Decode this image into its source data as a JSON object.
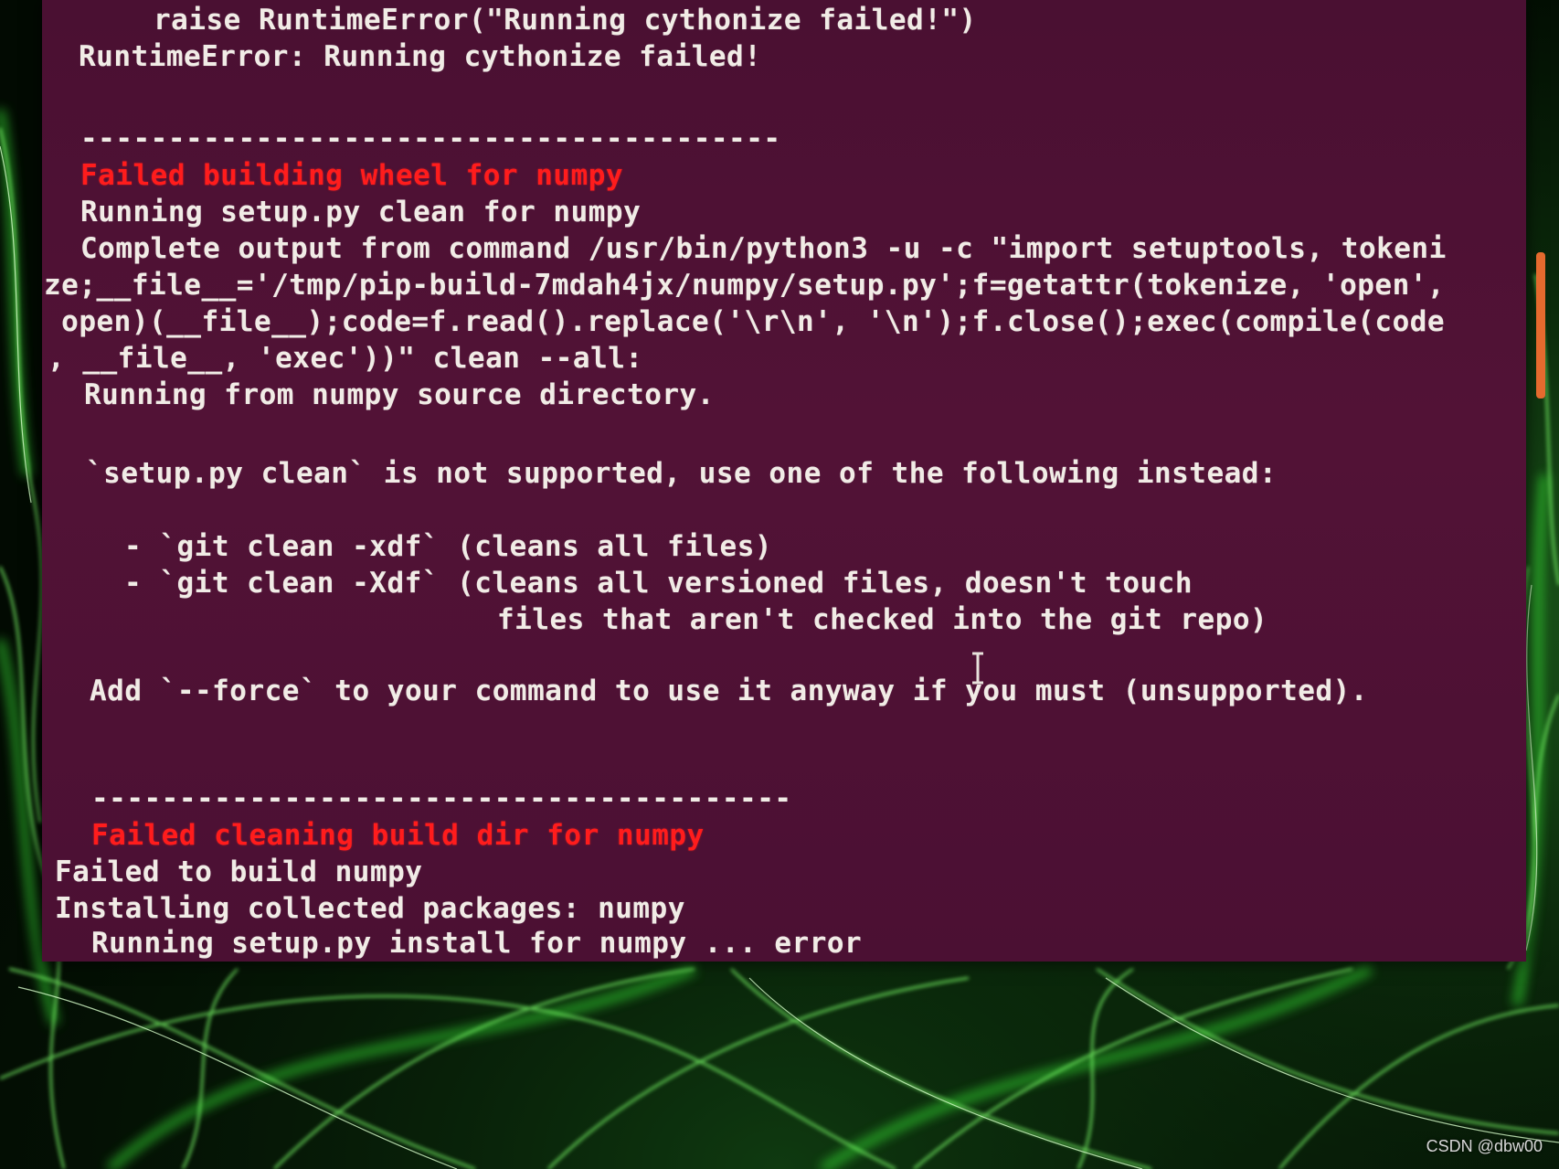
{
  "terminal": {
    "lines": [
      {
        "text": "raise RuntimeError(\"Running cythonize failed!\")",
        "color": "#f1ece6"
      },
      {
        "text": "RuntimeError: Running cythonize failed!",
        "color": "#f1ece6"
      },
      {
        "text": "----------------------------------------",
        "color": "#f1ece6"
      },
      {
        "text": "Failed building wheel for numpy",
        "color": "#ff1c1c"
      },
      {
        "text": "Running setup.py clean for numpy",
        "color": "#f1ece6"
      },
      {
        "text": "Complete output from command /usr/bin/python3 -u -c \"import setuptools, tokeni",
        "color": "#f1ece6"
      },
      {
        "text": "ze;__file__='/tmp/pip-build-7mdah4jx/numpy/setup.py';f=getattr(tokenize, 'open',",
        "color": "#f1ece6"
      },
      {
        "text": " open)(__file__);code=f.read().replace('\\r\\n', '\\n');f.close();exec(compile(code",
        "color": "#f1ece6"
      },
      {
        "text": ", __file__, 'exec'))\" clean --all:",
        "color": "#f1ece6"
      },
      {
        "text": "Running from numpy source directory.",
        "color": "#f1ece6"
      },
      {
        "text": "`setup.py clean` is not supported, use one of the following instead:",
        "color": "#f1ece6"
      },
      {
        "text": "- `git clean -xdf` (cleans all files)",
        "color": "#f1ece6"
      },
      {
        "text": "- `git clean -Xdf` (cleans all versioned files, doesn't touch",
        "color": "#f1ece6"
      },
      {
        "text": "files that aren't checked into the git repo)",
        "color": "#f1ece6"
      },
      {
        "text": "Add `--force` to your command to use it anyway if you must (unsupported).",
        "color": "#f1ece6"
      },
      {
        "text": "----------------------------------------",
        "color": "#f1ece6"
      },
      {
        "text": "Failed cleaning build dir for numpy",
        "color": "#ff1c1c"
      },
      {
        "text": "Failed to build numpy",
        "color": "#f1ece6"
      },
      {
        "text": "Installing collected packages: numpy",
        "color": "#f1ece6"
      },
      {
        "text": "Running setup.py install for numpy ... error",
        "color": "#f1ece6"
      }
    ],
    "background": "#4e1134",
    "error_color": "#ff1c1c",
    "scrollbar_color": "#e56a2e"
  },
  "watermark": "CSDN @dbw00"
}
